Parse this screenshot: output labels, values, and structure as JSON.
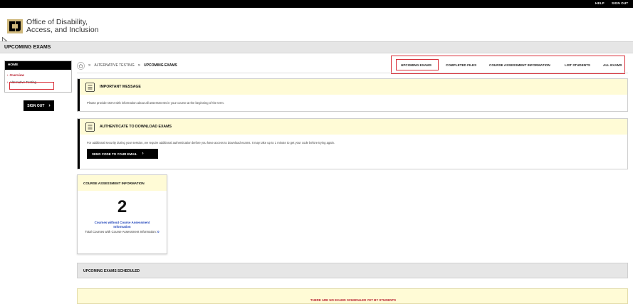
{
  "topbar": {
    "help": "HELP",
    "signout": "SIGN OUT"
  },
  "brand": {
    "line1": "Office of Disability,",
    "line2": "Access, and Inclusion"
  },
  "page_title": "UPCOMING EXAMS",
  "sidebar": {
    "home": "HOME",
    "items": [
      {
        "label": "Overview"
      },
      {
        "label": "Alternative Testing"
      }
    ],
    "signout": "SIGN OUT"
  },
  "breadcrumb": {
    "level1": "ALTERNATIVE TESTING",
    "current": "UPCOMING EXAMS"
  },
  "tabs": [
    {
      "label": "UPCOMING EXAMS"
    },
    {
      "label": "COMPLETED FILES"
    },
    {
      "label": "COURSE ASSESSMENT INFORMATION"
    },
    {
      "label": "LIST STUDENTS"
    },
    {
      "label": "ALL EXAMS"
    }
  ],
  "important": {
    "title": "IMPORTANT MESSAGE",
    "body": "Please provide ODAI with information about all assessments in your course at the beginning of the term."
  },
  "auth": {
    "title": "AUTHENTICATE TO DOWNLOAD EXAMS",
    "body": "For additional security during your session, we require additional authentication before you have access to download exams. It may take up to 1 minute to get your code before trying again.",
    "button": "SEND CODE TO YOUR EMAIL"
  },
  "assessment_card": {
    "title": "COURSE ASSESSMENT INFORMATION",
    "count": "2",
    "link": "Courses without Course Assessment Information",
    "total_label": "Total Courses with Course Assessment Information:",
    "total_value": "0"
  },
  "scheduled": {
    "title": "UPCOMING EXAMS SCHEDULED"
  },
  "no_exams": "THERE ARE NO EXAMS SCHEDULED YET BY STUDENTS",
  "colors": {
    "accent_red": "#b8202e",
    "highlight_yellow": "#fffbd6",
    "link_blue": "#1a3fb8"
  }
}
